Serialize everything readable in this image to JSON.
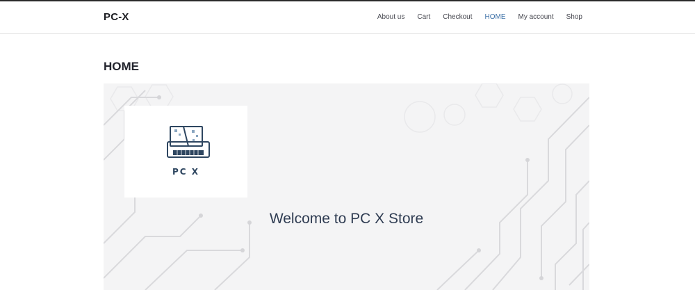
{
  "header": {
    "site_title": "PC-X",
    "nav": [
      {
        "label": "About us",
        "active": false
      },
      {
        "label": "Cart",
        "active": false
      },
      {
        "label": "Checkout",
        "active": false
      },
      {
        "label": "HOME",
        "active": true
      },
      {
        "label": "My account",
        "active": false
      },
      {
        "label": "Shop",
        "active": false
      }
    ],
    "active_color": "#3b6fa6"
  },
  "page": {
    "title": "HOME"
  },
  "hero": {
    "logo_text": "PC X",
    "welcome_text": "Welcome to PC X Store",
    "logo_icon": "computer-monitor-keyboard-icon"
  }
}
